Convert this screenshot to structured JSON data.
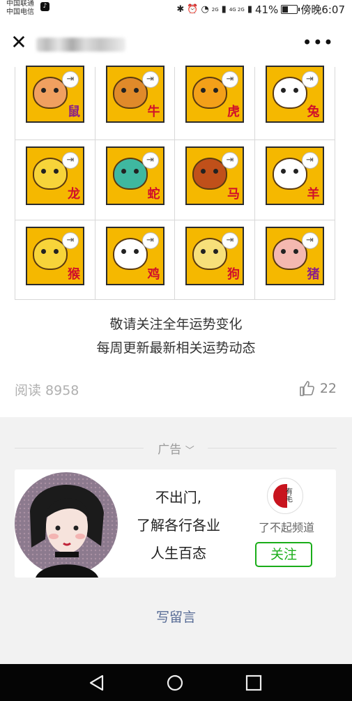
{
  "status_bar": {
    "carrier_1": "中国联通",
    "carrier_2": "中国电信",
    "battery_percent": "41%",
    "time": "傍晚6:07",
    "signal_1": "2G",
    "signal_2": "4G 2G",
    "battery_level": 0.41
  },
  "nav": {
    "close_icon": "close-icon",
    "more_label": "•••"
  },
  "zodiac": [
    {
      "label": "鼠",
      "animal": "rat",
      "color": "#f0a060",
      "label_color": "purple"
    },
    {
      "label": "牛",
      "animal": "ox",
      "color": "#e08a2a",
      "label_color": "red"
    },
    {
      "label": "虎",
      "animal": "tiger",
      "color": "#f3a019",
      "label_color": "red"
    },
    {
      "label": "兔",
      "animal": "rabbit",
      "color": "#ffffff",
      "label_color": "red"
    },
    {
      "label": "龙",
      "animal": "dragon",
      "color": "#f7d43a",
      "label_color": "red"
    },
    {
      "label": "蛇",
      "animal": "snake",
      "color": "#3fb8a0",
      "label_color": "red"
    },
    {
      "label": "马",
      "animal": "horse",
      "color": "#c0501a",
      "label_color": "red"
    },
    {
      "label": "羊",
      "animal": "goat",
      "color": "#ffffff",
      "label_color": "red"
    },
    {
      "label": "猴",
      "animal": "monkey",
      "color": "#f7d43a",
      "label_color": "red"
    },
    {
      "label": "鸡",
      "animal": "rooster",
      "color": "#ffffff",
      "label_color": "red"
    },
    {
      "label": "狗",
      "animal": "dog",
      "color": "#f7e07a",
      "label_color": "red"
    },
    {
      "label": "猪",
      "animal": "pig",
      "color": "#f4b8b0",
      "label_color": "purple"
    }
  ],
  "tile_badge_icon": "exit-icon",
  "caption": {
    "line1": "敬请关注全年运势变化",
    "line2": "每周更新最新相关运势动态"
  },
  "stats": {
    "read": "阅读 8958",
    "likes": "22",
    "like_icon": "thumbs-up-icon"
  },
  "ad": {
    "label": "广告",
    "text_line1": "不出门,",
    "text_line2": "了解各行各业",
    "text_line3": "人生百态",
    "brand_name": "了不起频道",
    "follow_label": "关注",
    "accent": "#1aad19"
  },
  "comment": {
    "label": "写留言",
    "color": "#576b95"
  },
  "system_nav": {
    "back_icon": "triangle-back-icon",
    "home_icon": "circle-home-icon",
    "recent_icon": "square-recent-icon"
  }
}
